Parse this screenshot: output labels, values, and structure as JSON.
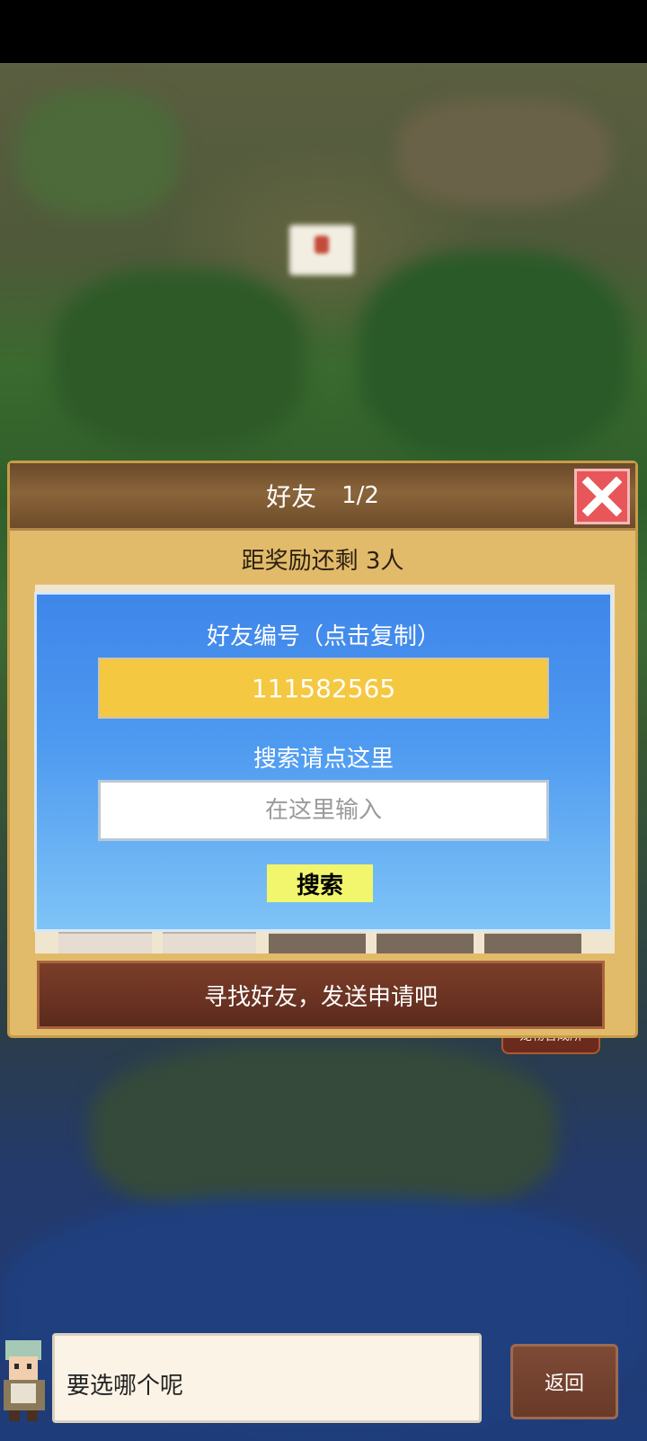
{
  "panel": {
    "title": "好友",
    "page": "1/2",
    "reward_text": "距奖励还剩 3人",
    "find_button": "寻找好友，发送申请吧"
  },
  "dialog": {
    "id_label": "好友编号（点击复制）",
    "friend_id": "111582565",
    "search_label": "搜索请点这里",
    "search_placeholder": "在这里输入",
    "search_button": "搜索"
  },
  "map": {
    "pet_building": "宠物合成所"
  },
  "footer": {
    "dialogue": "要选哪个呢",
    "back_button": "返回"
  },
  "colors": {
    "panel_bg": "#e2bb6a",
    "dialog_blue": "#4e9af0",
    "id_yellow": "#f5c842",
    "close_red": "#e7575a",
    "find_button": "#6a3222"
  },
  "icons": [
    "close-icon",
    "arrow-left-icon",
    "arrow-right-icon",
    "avatar-icon"
  ]
}
